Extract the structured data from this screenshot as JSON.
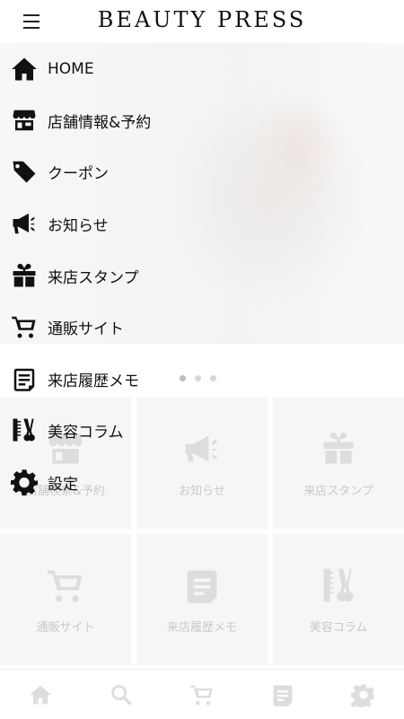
{
  "header": {
    "brand": "BEAUTY PRESS"
  },
  "drawer": {
    "items": [
      {
        "label": "HOME",
        "icon": "home-icon"
      },
      {
        "label": "店舗情報&予約",
        "icon": "store-icon"
      },
      {
        "label": "クーポン",
        "icon": "tag-icon"
      },
      {
        "label": "お知らせ",
        "icon": "megaphone-icon"
      },
      {
        "label": "来店スタンプ",
        "icon": "gift-icon"
      },
      {
        "label": "通販サイト",
        "icon": "cart-icon"
      },
      {
        "label": "来店履歴メモ",
        "icon": "memo-icon"
      },
      {
        "label": "美容コラム",
        "icon": "comb-scissors-icon"
      },
      {
        "label": "設定",
        "icon": "gear-icon"
      }
    ]
  },
  "tiles": [
    {
      "label": "店舗検索&予約",
      "icon": "store-icon"
    },
    {
      "label": "お知らせ",
      "icon": "megaphone-icon"
    },
    {
      "label": "来店スタンプ",
      "icon": "gift-icon"
    },
    {
      "label": "通販サイト",
      "icon": "cart-icon"
    },
    {
      "label": "来店履歴メモ",
      "icon": "memo-icon"
    },
    {
      "label": "美容コラム",
      "icon": "comb-scissors-icon"
    }
  ],
  "carousel": {
    "count": 3,
    "active": 0
  },
  "tabbar": [
    "home-icon",
    "search-icon",
    "cart-icon",
    "memo-icon",
    "gear-icon"
  ],
  "colors": {
    "icon_dark": "#111111",
    "icon_faded": "#dddddd",
    "tile_bg": "#f6f6f6"
  }
}
